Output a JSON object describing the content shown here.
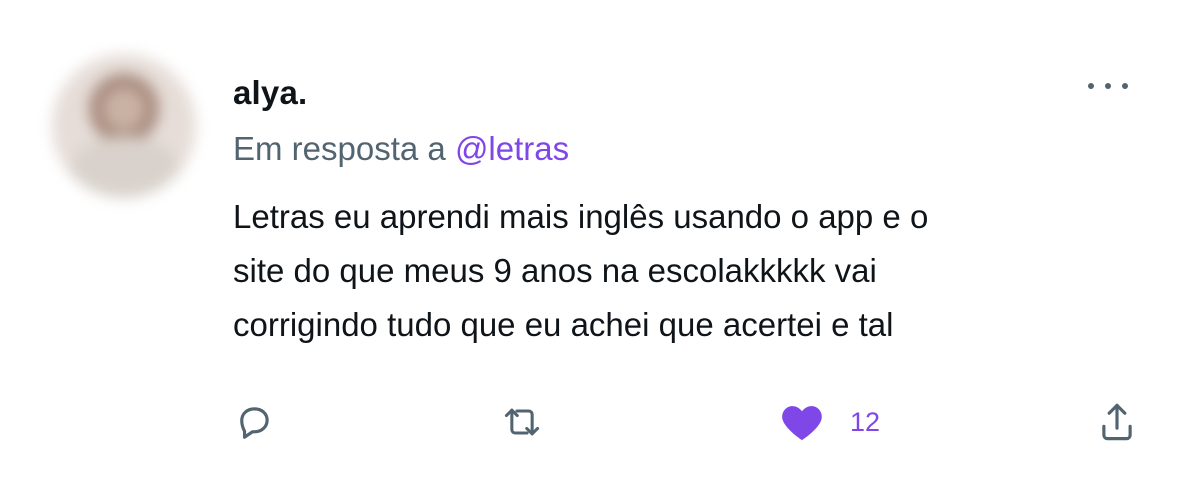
{
  "tweet": {
    "author": {
      "name": "alya."
    },
    "reply_to": {
      "prefix": "Em resposta a",
      "handle": "@letras"
    },
    "text_lines": [
      "Letras eu aprendi mais inglês usando o app e o",
      "site do que meus 9 anos na escolakkkkk vai",
      "corrigindo tudo que eu achei que acertei e tal"
    ],
    "actions": {
      "reply_icon": "reply-icon",
      "retweet_icon": "retweet-icon",
      "like_icon": "heart-icon",
      "like_count": "12",
      "share_icon": "share-icon"
    }
  },
  "colors": {
    "accent": "#7f46e8",
    "text": "#0f1419",
    "secondary": "#536471"
  }
}
